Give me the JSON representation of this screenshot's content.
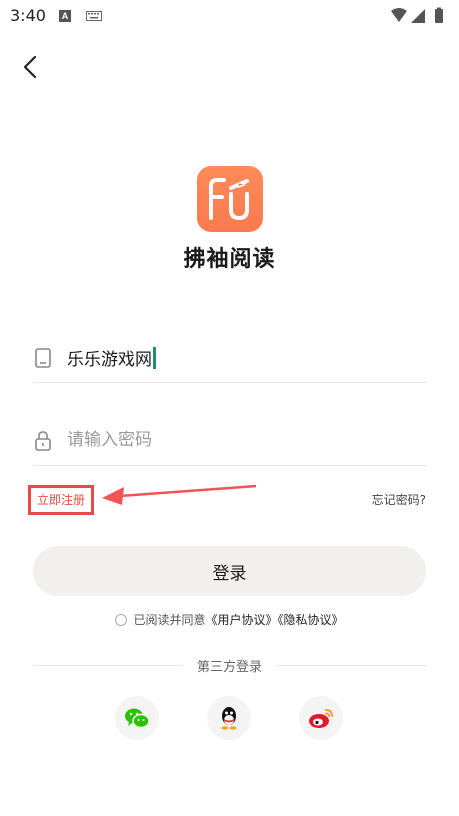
{
  "status_bar": {
    "time": "3:40",
    "a_badge": "A"
  },
  "app": {
    "logo_text": "Fu",
    "name": "拂袖阅读"
  },
  "login_form": {
    "username_value": "乐乐游戏网",
    "password_placeholder": "请输入密码"
  },
  "links": {
    "register": "立即注册",
    "forgot": "忘记密码?"
  },
  "login_button": "登录",
  "agreement": {
    "prefix": "已阅读并同意",
    "user_agreement": "《用户协议》",
    "privacy_agreement": "《隐私协议》"
  },
  "third_party": {
    "label": "第三方登录",
    "providers": [
      "wechat-icon",
      "qq-icon",
      "weibo-icon"
    ]
  },
  "colors": {
    "accent": "#f97a4e",
    "highlight": "#e84a4a",
    "caret": "#1f8f6f"
  }
}
